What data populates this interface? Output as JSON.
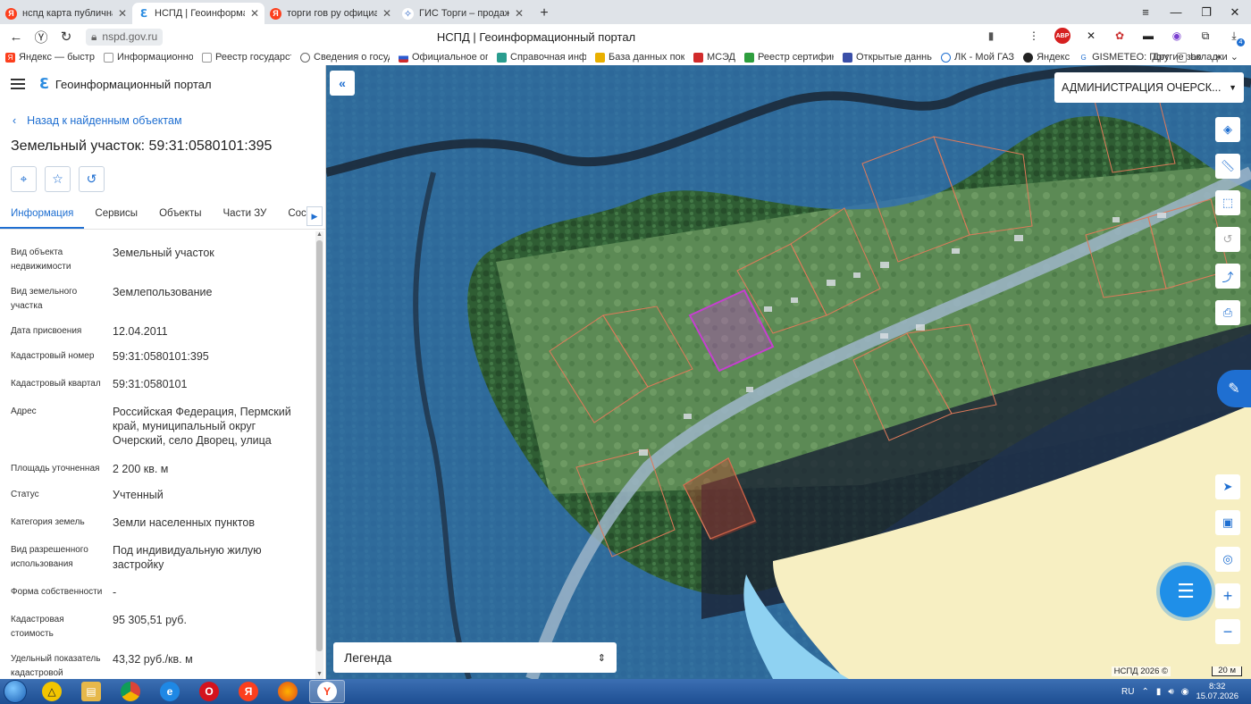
{
  "browser": {
    "tabs": [
      {
        "title": "нспд карта публичная кад",
        "icon": "yandex"
      },
      {
        "title": "НСПД | Геоинформацио",
        "icon": "nspd",
        "active": true
      },
      {
        "title": "торги гов ру официальны",
        "icon": "yandex"
      },
      {
        "title": "ГИС Торги – продажи гос",
        "icon": "gis"
      }
    ],
    "url": "nspd.gov.ru",
    "page_title": "НСПД | Геоинформационный портал",
    "bookmarks": [
      "Яндекс — быстрый",
      "Информационно",
      "Реестр государств",
      "Сведения о госуд",
      "Официальное опу",
      "Справочная инфо",
      "База данных пока",
      "МСЭД",
      "Реестр сертифика",
      "Открытые данные",
      "ЛК - Мой ГАЗ",
      "Яндекс",
      "GISMETEO: Погод",
      "Lo"
    ],
    "bookmarks_more": "Другие закладки",
    "abp_label": "ABP",
    "download_count": "4"
  },
  "panel": {
    "portal_name": "Геоинформационный портал",
    "back_link": "Назад к найденным объектам",
    "title": "Земельный участок: 59:31:0580101:395",
    "tabs": [
      "Информация",
      "Сервисы",
      "Объекты",
      "Части ЗУ",
      "Состав"
    ],
    "properties": [
      {
        "label": "Вид объекта недвижимости",
        "value": "Земельный участок"
      },
      {
        "label": "Вид земельного участка",
        "value": "Землепользование"
      },
      {
        "label": "Дата присвоения",
        "value": "12.04.2011"
      },
      {
        "label": "Кадастровый номер",
        "value": "59:31:0580101:395"
      },
      {
        "label": "Кадастровый квартал",
        "value": "59:31:0580101"
      },
      {
        "label": "Адрес",
        "value": "Российская Федерация, Пермский край, муниципальный округ Очерский, село Дворец, улица"
      },
      {
        "label": "Площадь уточненная",
        "value": "2 200 кв. м"
      },
      {
        "label": "Статус",
        "value": "Учтенный"
      },
      {
        "label": "Категория земель",
        "value": "Земли населенных пунктов"
      },
      {
        "label": "Вид разрешенного использования",
        "value": "Под индивидуальную жилую застройку"
      },
      {
        "label": "Форма собственности",
        "value": "-"
      },
      {
        "label": "Кадастровая стоимость",
        "value": "95 305,51 руб."
      },
      {
        "label": "Удельный показатель кадастровой",
        "value": "43,32 руб./кв. м"
      }
    ]
  },
  "map": {
    "admin_select": "АДМИНИСТРАЦИЯ ОЧЕРСК...",
    "legend": "Легенда",
    "attribution": "НСПД 2026 ©",
    "scale": "20 м",
    "colors": {
      "water_zone": "#2f6fb8",
      "selected_parcel": "#c63fd0",
      "parcel_border": "#e07a5a",
      "sand": "#f7efc2"
    }
  },
  "taskbar": {
    "lang": "RU",
    "time": "8:32",
    "date": "15.07.2026"
  }
}
